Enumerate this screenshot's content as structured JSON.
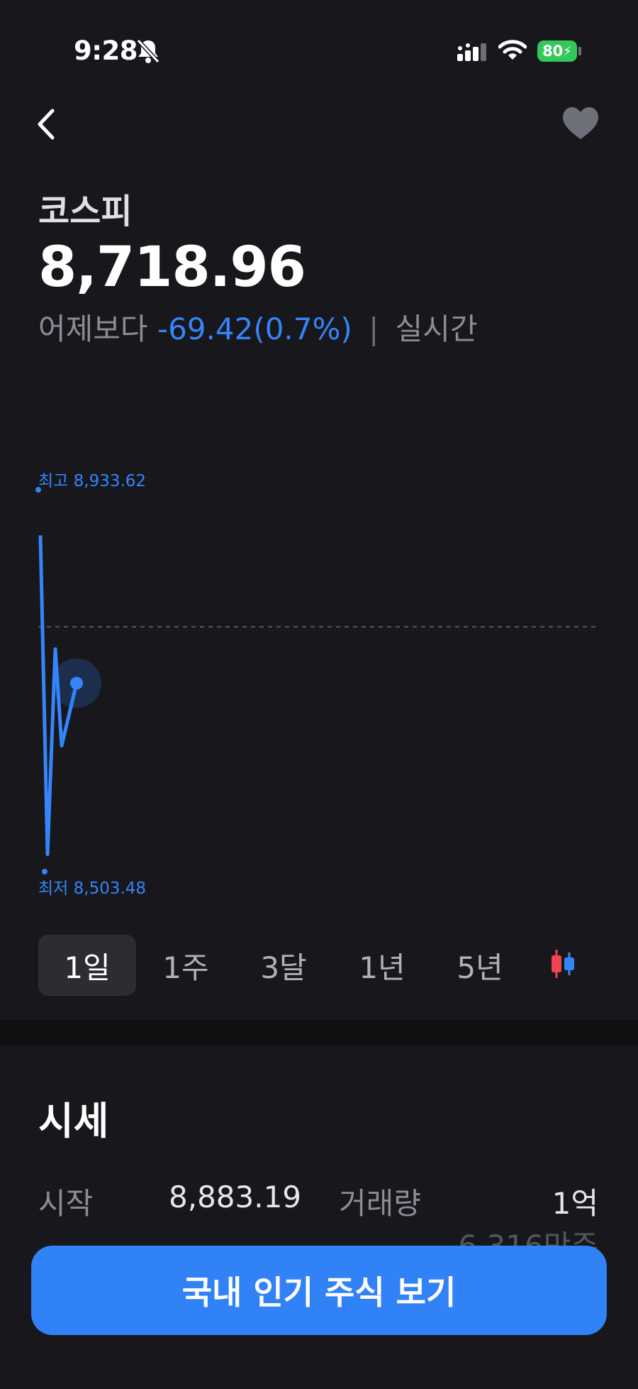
{
  "status_bar": {
    "time": "9:28",
    "battery": "80",
    "battery_color": "#34c759"
  },
  "header": {
    "stock_name": "코스피",
    "price": "8,718.96",
    "change_prefix": "어제보다",
    "change_value": "-69.42(0.7%)",
    "separator": "|",
    "realtime_label": "실시간"
  },
  "chart_data": {
    "type": "line",
    "period": "1일",
    "high_label": "최고 8,933.62",
    "low_label": "최저 8,503.48",
    "high": 8933.62,
    "low": 8503.48,
    "previous_close": 8788.38,
    "current": 8718.96,
    "values": [
      8901.0,
      8508.0,
      8761.0,
      8642.0,
      8718.96
    ],
    "series_color": "#3485fa",
    "gridline": "dashed previous close"
  },
  "period_tabs": [
    "1일",
    "1주",
    "3달",
    "1년",
    "5년"
  ],
  "active_tab": "1일",
  "quote_section": {
    "title": "시세",
    "open_label": "시작",
    "open_value": "8,883.19",
    "volume_label": "거래량",
    "volume_value": "1억",
    "volume_sub": "6,316만주"
  },
  "cta": {
    "label": "국내 인기 주식 보기",
    "color": "#3182f6"
  },
  "icons": [
    "bell-slash-icon",
    "signal-icon",
    "wifi-icon",
    "back-icon",
    "heart-icon",
    "candlestick-icon"
  ]
}
